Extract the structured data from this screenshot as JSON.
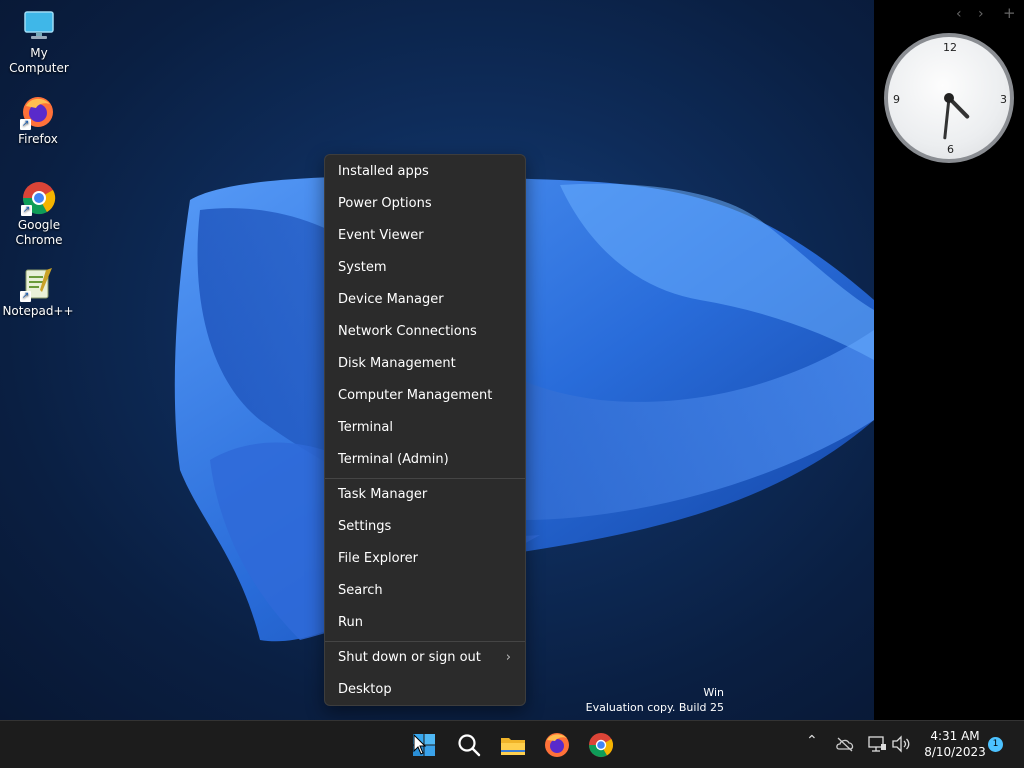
{
  "desktop": {
    "icons": [
      {
        "label": "My Computer",
        "icon": "monitor-icon"
      },
      {
        "label": "Firefox",
        "icon": "firefox-icon"
      },
      {
        "label": "Google Chrome",
        "icon": "chrome-icon"
      },
      {
        "label": "Notepad++",
        "icon": "notepadpp-icon"
      }
    ],
    "watermark": {
      "line1": "Win",
      "line2": "Evaluation copy. Build 25"
    }
  },
  "widget": {
    "nav_prev": "‹",
    "nav_next": "›",
    "add": "+",
    "clock": {
      "n12": "12",
      "n3": "3",
      "n6": "6",
      "n9": "9",
      "hour": 4,
      "minute": 31
    }
  },
  "context_menu": {
    "group1": [
      "Installed apps",
      "Power Options",
      "Event Viewer",
      "System",
      "Device Manager",
      "Network Connections",
      "Disk Management",
      "Computer Management",
      "Terminal",
      "Terminal (Admin)"
    ],
    "group2": [
      "Task Manager",
      "Settings",
      "File Explorer",
      "Search",
      "Run"
    ],
    "group3": [
      "Shut down or sign out",
      "Desktop"
    ],
    "submenu_arrow": "›"
  },
  "taskbar": {
    "apps": [
      "start-icon",
      "search-icon",
      "file-explorer-icon",
      "firefox-icon",
      "chrome-icon"
    ],
    "tray": {
      "chevron": "⌃",
      "icons": [
        "onedrive-icon",
        "network-icon",
        "volume-icon"
      ]
    },
    "time": "4:31 AM",
    "date": "8/10/2023",
    "notification_count": "1"
  },
  "colors": {
    "menu_bg": "#2b2b2b",
    "taskbar_bg": "#1c1c1c",
    "accent": "#4cc2ff"
  }
}
